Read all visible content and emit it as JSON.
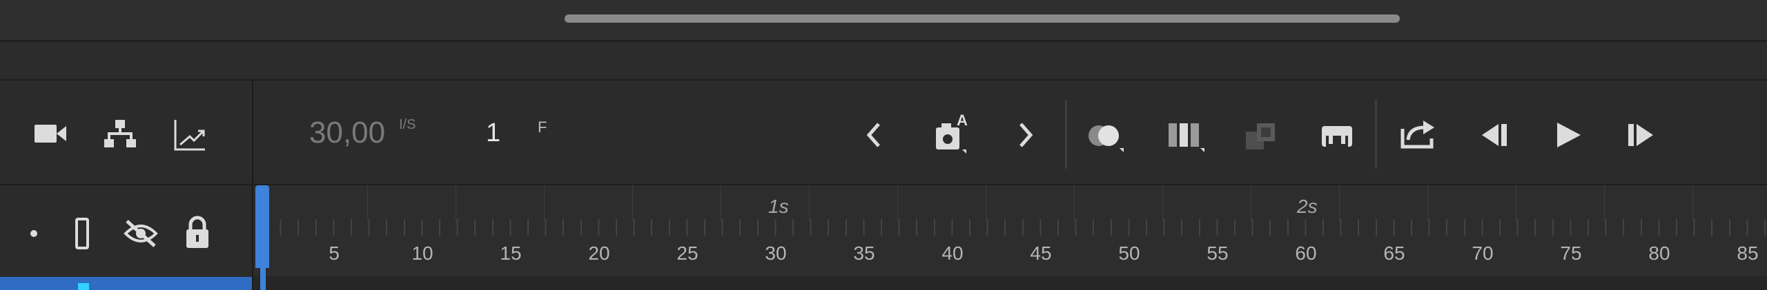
{
  "toolbar": {
    "fps_value": "30,00",
    "fps_unit": "I/S",
    "frame_value": "1",
    "frame_unit": "F"
  },
  "left_icons": [
    "camera-icon",
    "layer-parenting-icon",
    "graph-icon"
  ],
  "layer_icons": [
    "dot-icon",
    "outline-icon",
    "eye-hidden-icon",
    "lock-icon"
  ],
  "playback_icons": [
    "prev-keyframe-icon",
    "insert-keyframe-icon",
    "next-keyframe-icon",
    "onion-skin-icon",
    "edit-multiple-frames-icon",
    "disabled-frames-icon",
    "loop-icon",
    "export-icon",
    "step-back-icon",
    "play-icon",
    "step-forward-icon"
  ],
  "timeline": {
    "seconds": [
      "1s",
      "2s"
    ],
    "frames": [
      "5",
      "10",
      "15",
      "20",
      "25",
      "30",
      "35",
      "40",
      "45",
      "50",
      "55",
      "60",
      "65",
      "70",
      "75",
      "80",
      "85"
    ]
  },
  "colors": {
    "accent": "#3f82d9",
    "layer_bar": "#2f6cc2",
    "cyan_marker": "#2fd3ff"
  }
}
